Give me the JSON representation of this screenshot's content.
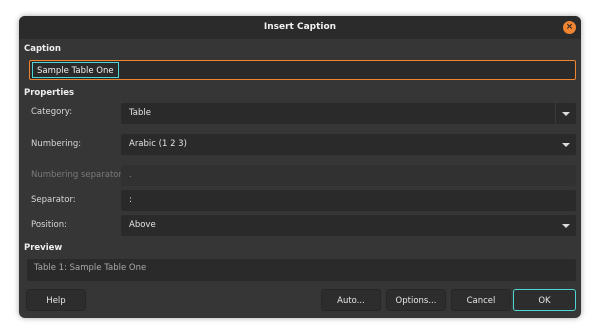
{
  "window": {
    "title": "Insert Caption",
    "close_icon": "close-icon",
    "accent": "#f08430"
  },
  "caption": {
    "heading": "Caption",
    "value": "Sample Table One"
  },
  "properties": {
    "heading": "Properties",
    "category": {
      "label": "Category:",
      "value": "Table"
    },
    "numbering": {
      "label": "Numbering:",
      "value": "Arabic (1 2 3)"
    },
    "numbering_separator": {
      "label": "Numbering separator:",
      "value": "."
    },
    "separator": {
      "label": "Separator:",
      "value": ":"
    },
    "position": {
      "label": "Position:",
      "value": "Above"
    }
  },
  "preview": {
    "heading": "Preview",
    "text": "Table 1: Sample Table One"
  },
  "buttons": {
    "help": "Help",
    "auto": "Auto...",
    "options": "Options...",
    "cancel": "Cancel",
    "ok": "OK"
  },
  "focus_color": "#4ed6d6"
}
